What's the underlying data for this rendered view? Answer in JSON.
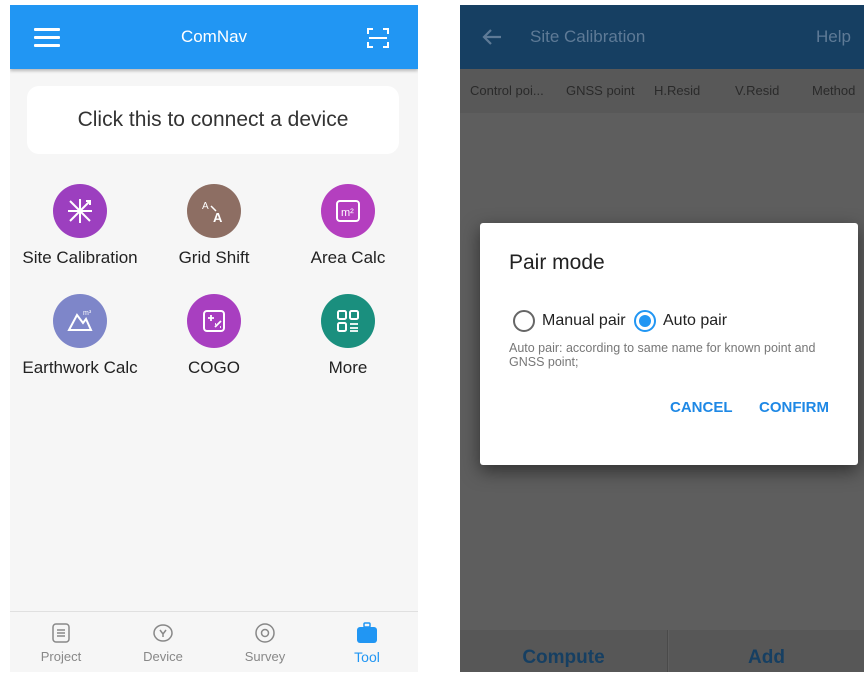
{
  "left": {
    "app_title": "ComNav",
    "connect_text": "Click this to connect a device",
    "tools": [
      {
        "label": "Site Calibration",
        "icon": "site-calibration-icon",
        "color": "#9c3fbf"
      },
      {
        "label": "Grid Shift",
        "icon": "grid-shift-icon",
        "color": "#8d6e63"
      },
      {
        "label": "Area Calc",
        "icon": "area-calc-icon",
        "color": "#b43fbf"
      },
      {
        "label": "Earthwork Calc",
        "icon": "earthwork-calc-icon",
        "color": "#7e86c9"
      },
      {
        "label": "COGO",
        "icon": "cogo-icon",
        "color": "#a83fc0"
      },
      {
        "label": "More",
        "icon": "more-grid-icon",
        "color": "#1a8f7e"
      }
    ],
    "tabs": [
      {
        "label": "Project",
        "icon": "project-icon"
      },
      {
        "label": "Device",
        "icon": "device-icon"
      },
      {
        "label": "Survey",
        "icon": "survey-icon"
      },
      {
        "label": "Tool",
        "icon": "tool-icon",
        "active": true
      }
    ],
    "accent": "#2196f3"
  },
  "right": {
    "title": "Site Calibration",
    "help": "Help",
    "columns": [
      "Control poi...",
      "GNSS point",
      "H.Resid",
      "V.Resid",
      "Method"
    ],
    "dialog": {
      "title": "Pair mode",
      "options": [
        {
          "label": "Manual pair",
          "checked": false
        },
        {
          "label": "Auto pair",
          "checked": true
        }
      ],
      "hint": "Auto pair: according to same name for known point and GNSS point;",
      "cancel": "CANCEL",
      "confirm": "CONFIRM"
    },
    "bottom_buttons": [
      "Compute",
      "Add"
    ]
  }
}
